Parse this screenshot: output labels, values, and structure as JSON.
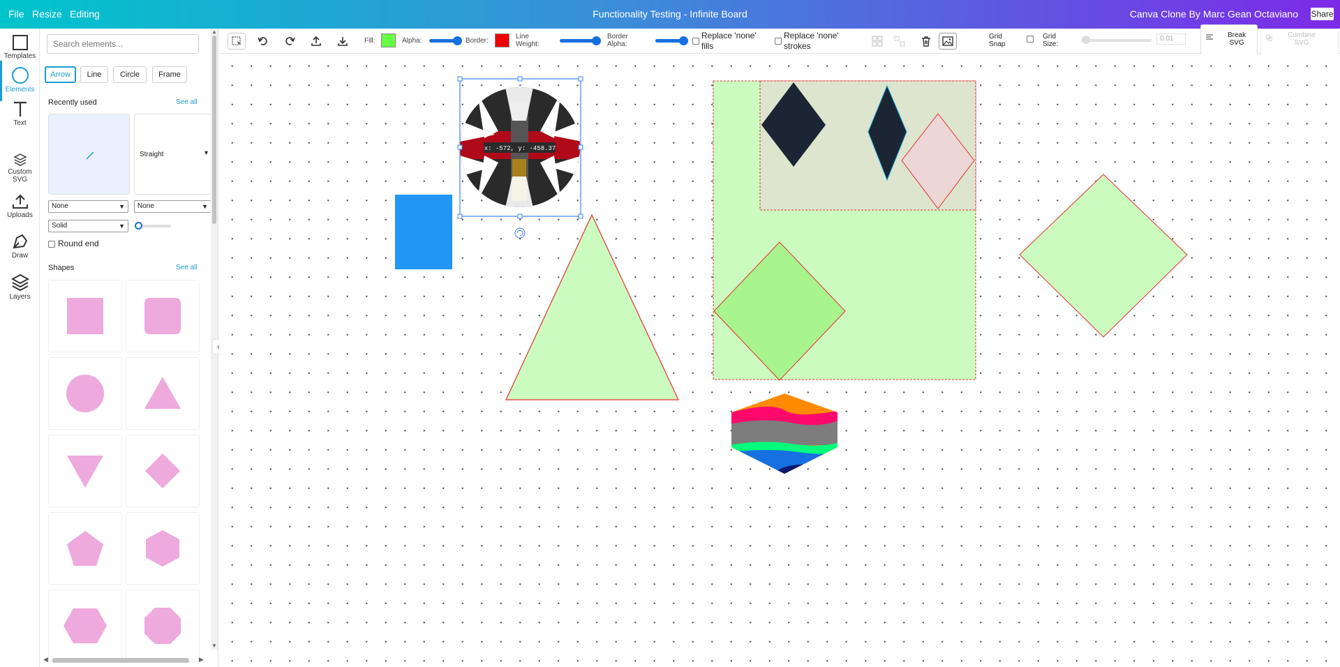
{
  "header": {
    "menu": [
      "File",
      "Resize",
      "Editing"
    ],
    "title": "Functionality Testing - Infinite Board",
    "credit": "Canva Clone By Marc Gean Octaviano",
    "share_label": "Share"
  },
  "rail": [
    {
      "label": "Templates",
      "icon": "templates-icon"
    },
    {
      "label": "Elements",
      "icon": "elements-icon",
      "active": true
    },
    {
      "label": "Text",
      "icon": "text-icon"
    },
    {
      "label": "Custom SVG",
      "icon": "layers-svg-icon"
    },
    {
      "label": "Uploads",
      "icon": "upload-icon"
    },
    {
      "label": "Draw",
      "icon": "pen-icon"
    },
    {
      "label": "Layers",
      "icon": "layers-icon"
    }
  ],
  "panel": {
    "search_placeholder": "Search elements...",
    "tabs": [
      "Arrow",
      "Line",
      "Circle",
      "Frame"
    ],
    "selected_tab": "Arrow",
    "recently_used_title": "Recently used",
    "see_all": "See all",
    "recent_items": [
      "",
      "Straight"
    ],
    "start_cap": "None",
    "end_cap": "None",
    "dash_style": "Solid",
    "round_end_label": "Round end",
    "shapes_title": "Shapes",
    "shape_color": "#eea9dd"
  },
  "toolbar": {
    "fill_label": "Fill:",
    "fill_color": "#66ff44",
    "alpha_label": "Alpha:",
    "border_label": "Border:",
    "border_color": "#ee0000",
    "line_weight_label_1": "Line",
    "line_weight_label_2": "Weight:",
    "border_alpha_label_1": "Border",
    "border_alpha_label_2": "Alpha:",
    "replace_fills_1": "Replace 'none'",
    "replace_fills_2": "fills",
    "replace_strokes_1": "Replace 'none'",
    "replace_strokes_2": "strokes",
    "grid_snap_1": "Grid",
    "grid_snap_2": "Snap",
    "grid_size_1": "Grid",
    "grid_size_2": "Size:",
    "grid_size_value": "0.01",
    "break_svg_1": "Break",
    "break_svg_2": "SVG",
    "combine_svg_1": "Combine",
    "combine_svg_2": "SVG"
  },
  "canvas": {
    "coord_readout": "x: -572, y: -458.37",
    "colors": {
      "light_green": "#ccfbc0",
      "green": "#a8f58e",
      "red": "#e23030",
      "blue": "#2196f3",
      "dark_navy": "#1b2533",
      "selection": "#3b82f6"
    }
  }
}
